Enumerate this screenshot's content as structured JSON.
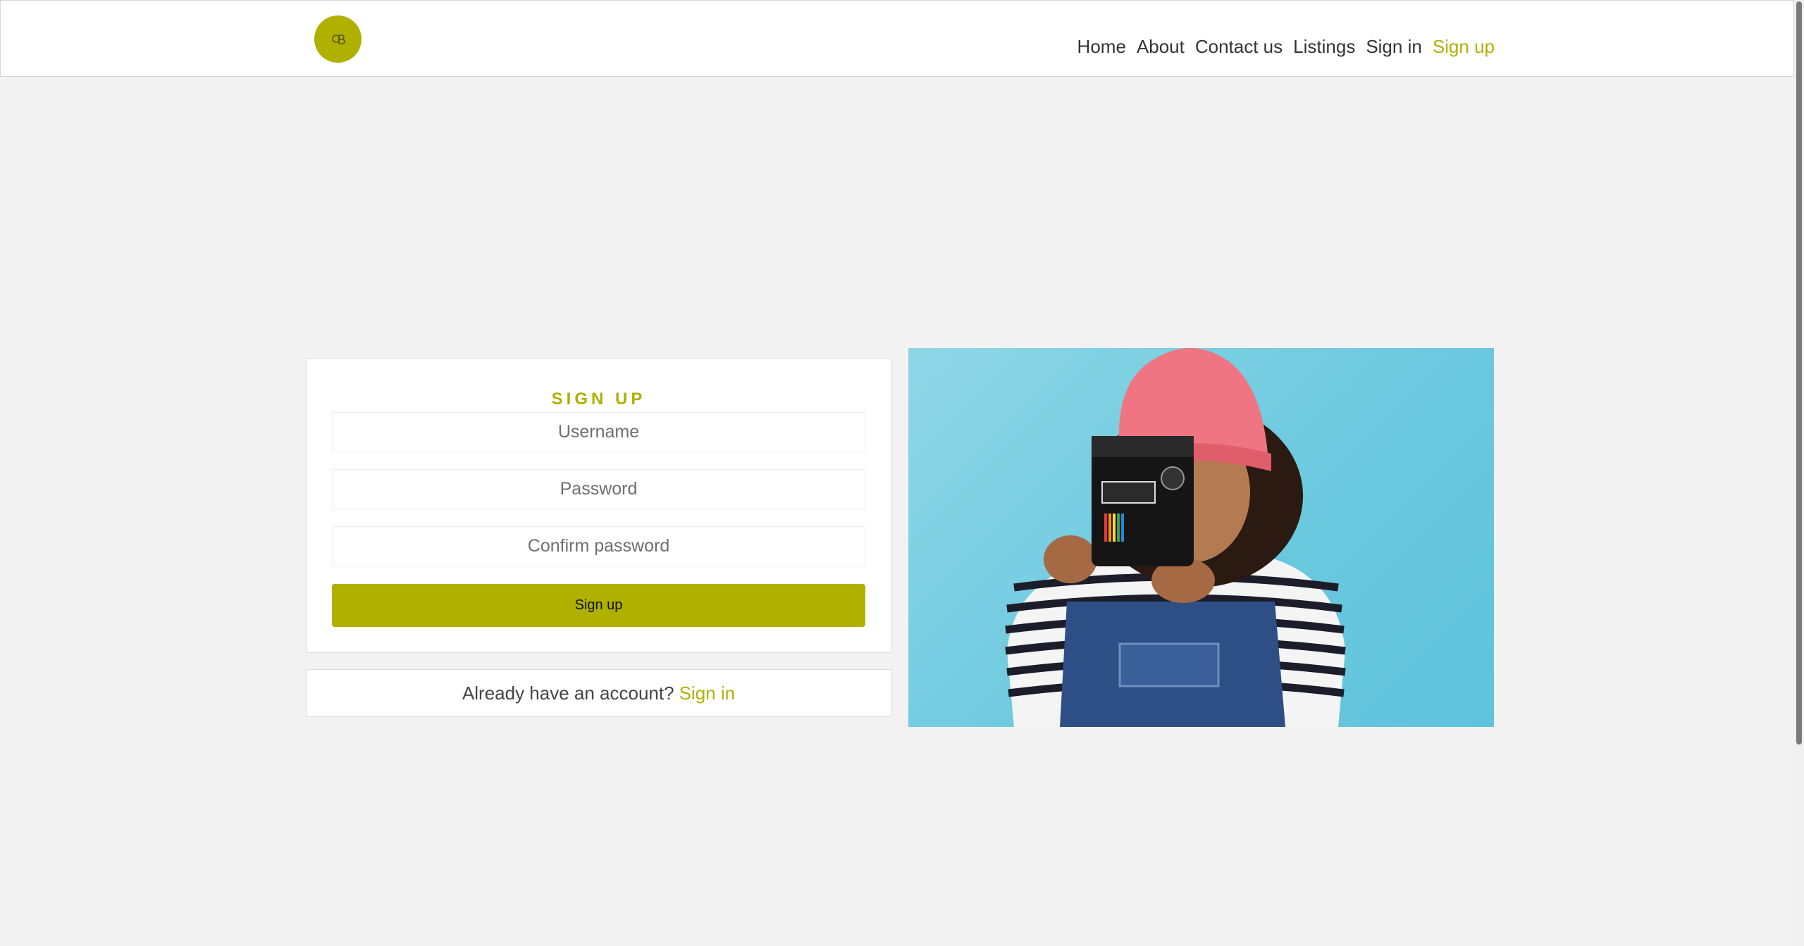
{
  "nav": {
    "logo_icon": "cb-logo-icon",
    "links": [
      {
        "label": "Home"
      },
      {
        "label": "About"
      },
      {
        "label": "Contact us"
      },
      {
        "label": "Listings"
      },
      {
        "label": "Sign in"
      },
      {
        "label": "Sign up",
        "active": true
      }
    ]
  },
  "signup_form": {
    "title": "SIGN UP",
    "username_placeholder": "Username",
    "password_placeholder": "Password",
    "confirm_placeholder": "Confirm password",
    "button_label": "Sign up"
  },
  "signin_prompt": {
    "text": "Already have an account?",
    "link": "Sign in"
  },
  "colors": {
    "accent": "#afb000",
    "background": "#f2f2f2",
    "photo_background": "#6cc9df"
  }
}
